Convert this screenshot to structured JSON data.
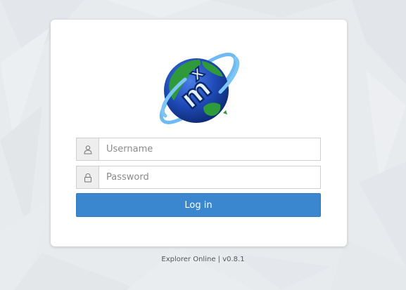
{
  "login_form": {
    "logo": "globe-mx-logo",
    "username": {
      "icon": "user-icon",
      "placeholder": "Username",
      "value": ""
    },
    "password": {
      "icon": "lock-icon",
      "placeholder": "Password",
      "value": ""
    },
    "submit_label": "Log in"
  },
  "footer": {
    "text": "Explorer Online | v0.8.1"
  },
  "colors": {
    "accent": "#3a87cf",
    "background": "#e9ecef",
    "card": "#ffffff"
  }
}
